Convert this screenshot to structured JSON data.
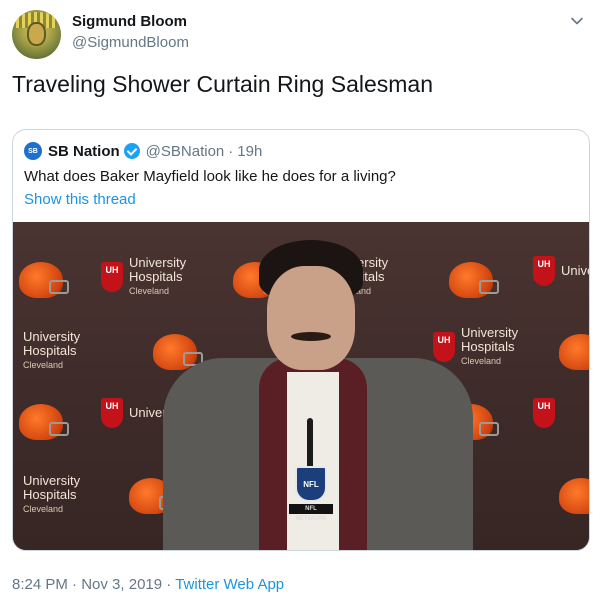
{
  "author": {
    "name": "Sigmund Bloom",
    "handle": "@SigmundBloom",
    "avatar_icon": "avatar-illustration-icon"
  },
  "tweet": {
    "text": "Traveling Shower Curtain Ring Salesman"
  },
  "quoted": {
    "name": "SB Nation",
    "handle": "@SBNation",
    "separator": "·",
    "time": "19h",
    "avatar_text": "SB",
    "text": "What does Baker Mayfield look like he does for a living?",
    "link": "Show this thread",
    "photo": {
      "backdrop_sponsor": [
        "University",
        "Hospitals",
        "Cleveland"
      ],
      "shield_text": "UH",
      "mic_badge": "NFL",
      "mic_label": "NFL NETWORK"
    }
  },
  "footer": {
    "time": "8:24 PM",
    "separator1": "·",
    "date": "Nov 3, 2019",
    "separator2": "·",
    "app": "Twitter Web App"
  },
  "colors": {
    "link": "#1b95e0",
    "verified": "#1da1f2",
    "muted": "#657786",
    "border": "#ccd6dd"
  }
}
